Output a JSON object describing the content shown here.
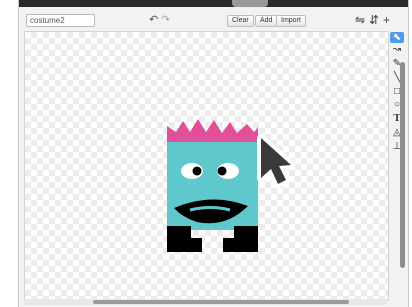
{
  "editor": {
    "costume_name": "costume2",
    "buttons": {
      "clear": "Clear",
      "add": "Add",
      "import": "Import"
    },
    "history": {
      "undo_icon": "↶",
      "redo_icon": "↷"
    },
    "transform_icons": [
      "flip-horizontal-icon",
      "flip-vertical-icon",
      "set-center-icon"
    ]
  },
  "tools": [
    {
      "name": "select-tool",
      "glyph": "⬉",
      "active": true
    },
    {
      "name": "reshape-tool",
      "glyph": "↝"
    },
    {
      "name": "pencil-tool",
      "glyph": "✎"
    },
    {
      "name": "line-tool",
      "glyph": "╲"
    },
    {
      "name": "rectangle-tool",
      "glyph": "□"
    },
    {
      "name": "ellipse-tool",
      "glyph": "○"
    },
    {
      "name": "text-tool",
      "glyph": "T"
    },
    {
      "name": "fill-tool",
      "glyph": "◬"
    },
    {
      "name": "stamp-tool",
      "glyph": "⊥"
    }
  ],
  "colors": {
    "sprite_body": "#5ec8cc",
    "sprite_crown": "#e0509a",
    "sprite_dark": "#000000",
    "tool_active": "#4c9be8"
  }
}
